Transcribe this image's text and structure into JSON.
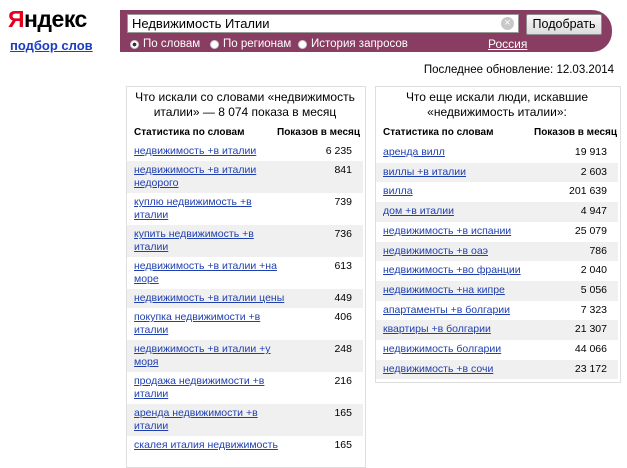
{
  "brand": {
    "logo_first": "Я",
    "logo_rest": "ндекс",
    "subtitle": "подбор слов"
  },
  "search": {
    "value": "Недвижимость Италии",
    "button": "Подобрать",
    "region": "Россия"
  },
  "radios": [
    {
      "label": "По словам",
      "checked": true
    },
    {
      "label": "По регионам",
      "checked": false
    },
    {
      "label": "История запросов",
      "checked": false
    }
  ],
  "updated": "Последнее обновление: 12.03.2014",
  "left": {
    "title_line1": "Что искали со словами «недвижимость",
    "title_line2": "италии» — 8 074 показа в месяц",
    "col1": "Статистика по словам",
    "col2": "Показов в месяц",
    "rows": [
      {
        "line1": "недвижимость +в италии",
        "line2": "",
        "count": "6 235"
      },
      {
        "line1": "недвижимость +в италии",
        "line2": "недорого",
        "count": "841"
      },
      {
        "line1": "куплю недвижимость +в",
        "line2": "италии",
        "count": "739"
      },
      {
        "line1": "купить недвижимость +в",
        "line2": "италии",
        "count": "736"
      },
      {
        "line1": "недвижимость +в италии +на",
        "line2": "море",
        "count": "613"
      },
      {
        "line1": "недвижимость +в италии цены",
        "line2": "",
        "count": "449"
      },
      {
        "line1": "покупка недвижимости +в",
        "line2": "италии",
        "count": "406"
      },
      {
        "line1": "недвижимость +в италии +у",
        "line2": "моря",
        "count": "248"
      },
      {
        "line1": "продажа недвижимости +в",
        "line2": "италии",
        "count": "216"
      },
      {
        "line1": "аренда недвижимости +в",
        "line2": "италии",
        "count": "165"
      },
      {
        "line1": "скалея италия недвижимость",
        "line2": "",
        "count": "165"
      }
    ]
  },
  "right": {
    "title_line1": "Что еще искали люди, искавшие",
    "title_line2": "«недвижимость италии»:",
    "col1": "Статистика по словам",
    "col2": "Показов в месяц",
    "rows": [
      {
        "line1": "аренда вилл",
        "count": "19 913"
      },
      {
        "line1": "виллы +в италии",
        "count": "2 603"
      },
      {
        "line1": "вилла",
        "count": "201 639"
      },
      {
        "line1": "дом +в италии",
        "count": "4 947"
      },
      {
        "line1": "недвижимость +в испании",
        "count": "25 079"
      },
      {
        "line1": "недвижимость +в оаэ",
        "count": "786"
      },
      {
        "line1": "недвижимость +во франции",
        "count": "2 040"
      },
      {
        "line1": "недвижимость +на кипре",
        "count": "5 056"
      },
      {
        "line1": "апартаменты +в болгарии",
        "count": "7 323"
      },
      {
        "line1": "квартиры +в болгарии",
        "count": "21 307"
      },
      {
        "line1": "недвижимость болгарии",
        "count": "44 066"
      },
      {
        "line1": "недвижимость +в сочи",
        "count": "23 172"
      }
    ]
  }
}
